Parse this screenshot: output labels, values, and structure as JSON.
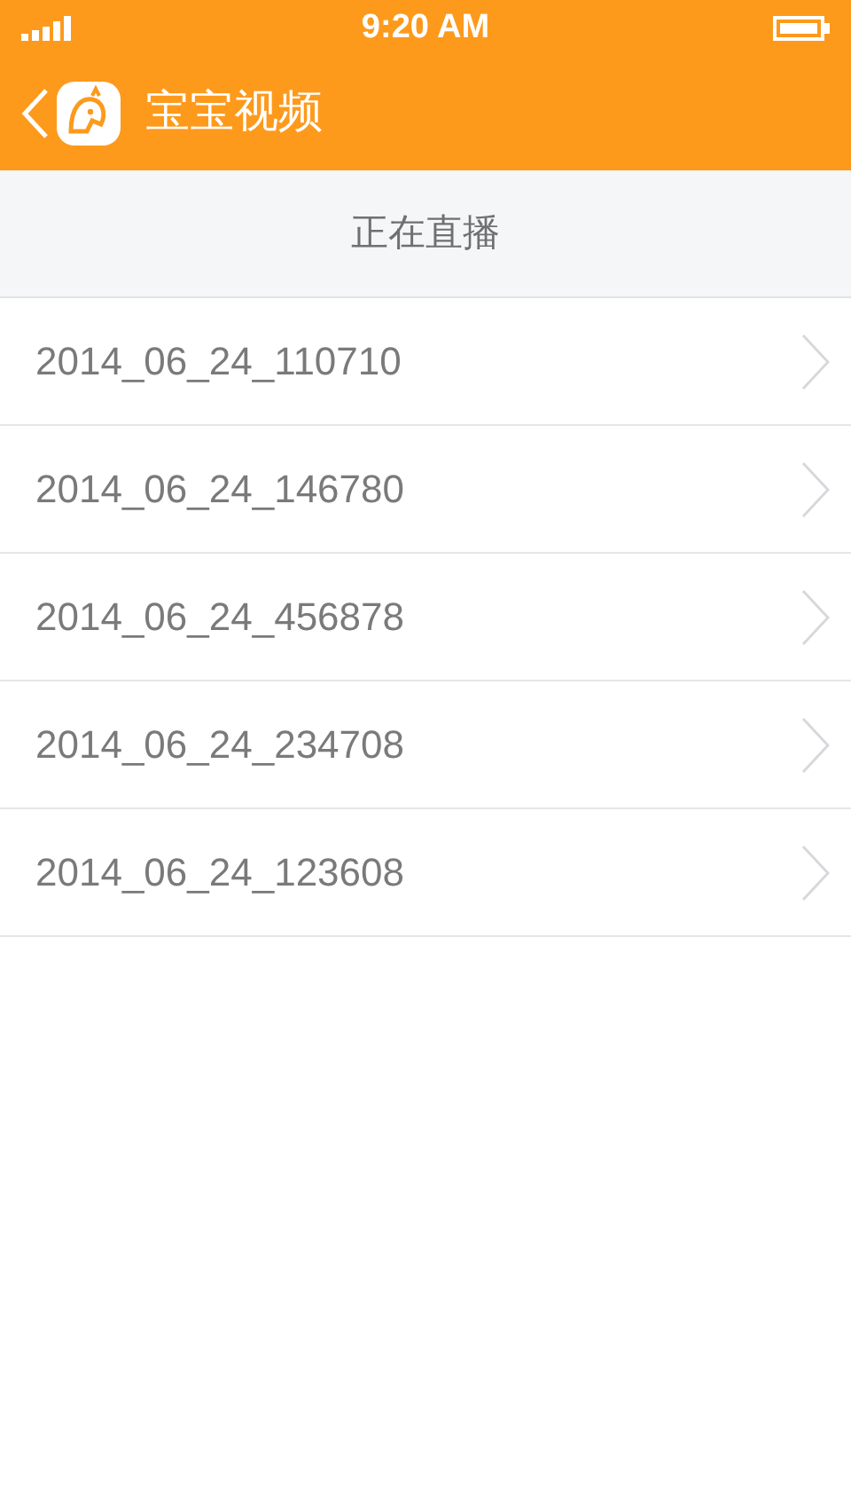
{
  "status_bar": {
    "time": "9:20 AM"
  },
  "header": {
    "title": "宝宝视频"
  },
  "section": {
    "title": "正在直播"
  },
  "videos": [
    {
      "name": "2014_06_24_110710"
    },
    {
      "name": "2014_06_24_146780"
    },
    {
      "name": "2014_06_24_456878"
    },
    {
      "name": "2014_06_24_234708"
    },
    {
      "name": "2014_06_24_123608"
    }
  ]
}
